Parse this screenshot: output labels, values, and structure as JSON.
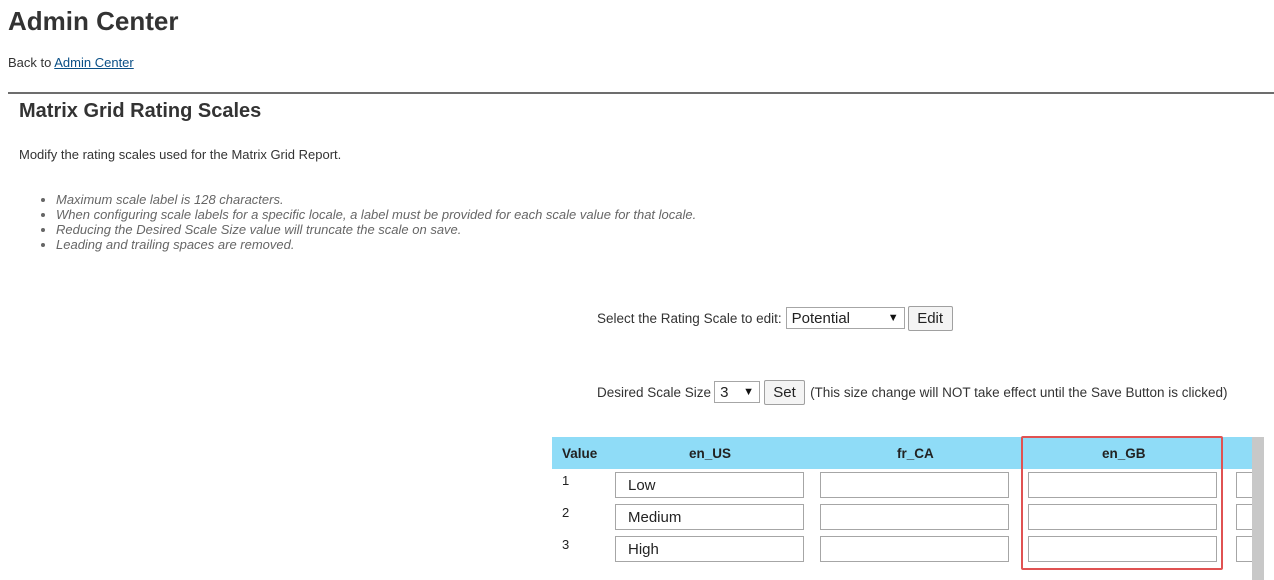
{
  "app_title": "Admin Center",
  "back": {
    "prefix": "Back to",
    "link_label": "Admin Center"
  },
  "section": {
    "title": "Matrix Grid Rating Scales",
    "description": "Modify the rating scales used for the Matrix Grid Report.",
    "notes": [
      "Maximum scale label is 128 characters.",
      "When configuring scale labels for a specific locale, a label must be provided for each scale value for that locale.",
      "Reducing the Desired Scale Size value will truncate the scale on save.",
      "Leading and trailing spaces are removed."
    ]
  },
  "rating_scale": {
    "label": "Select the Rating Scale to edit:",
    "selected": "Potential",
    "edit_label": "Edit"
  },
  "scale_size": {
    "label": "Desired Scale Size",
    "selected": "3",
    "set_label": "Set",
    "note": "(This size change will NOT take effect until the Save Button is clicked)"
  },
  "grid": {
    "headers": [
      "Value",
      "en_US",
      "fr_CA",
      "en_GB"
    ],
    "rows": [
      {
        "value": "1",
        "en_US": "Low",
        "fr_CA": "",
        "en_GB": ""
      },
      {
        "value": "2",
        "en_US": "Medium",
        "fr_CA": "",
        "en_GB": ""
      },
      {
        "value": "3",
        "en_US": "High",
        "fr_CA": "",
        "en_GB": ""
      }
    ]
  },
  "colors": {
    "header_bg": "#8fdcf7",
    "highlight_border": "#e05252",
    "link": "#0a4f86"
  }
}
